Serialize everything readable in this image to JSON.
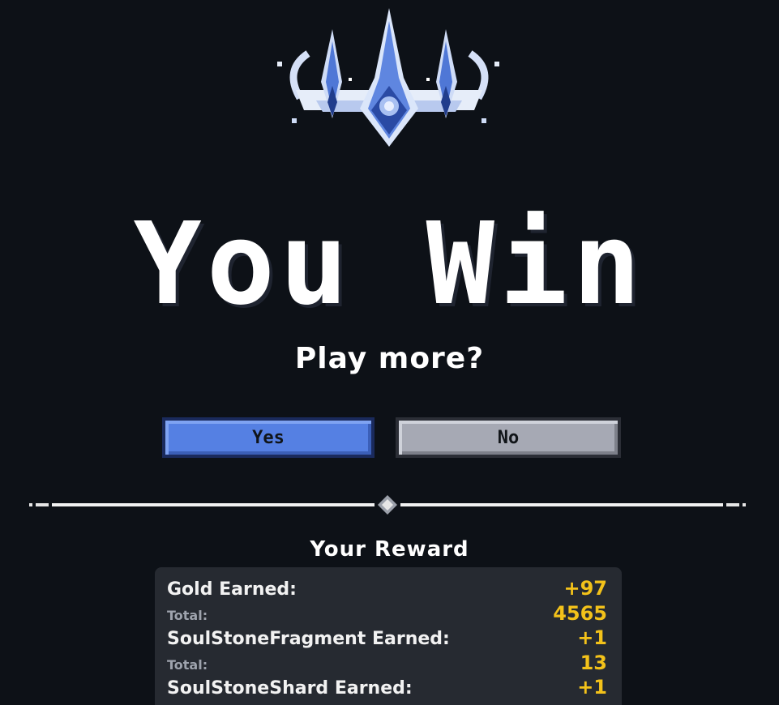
{
  "title": "You Win",
  "subtitle": "Play more?",
  "buttons": {
    "yes_label": "Yes",
    "no_label": "No"
  },
  "colors": {
    "background": "#0d1117",
    "yes_button": "#5580e3",
    "no_button": "#a6a9b4",
    "reward_value": "#f3c21a",
    "panel": "#262a31"
  },
  "icons": {
    "crown": "crown-icon",
    "divider_ornament": "diamond-ornament-icon"
  },
  "reward": {
    "title": "Your Reward",
    "rows": [
      {
        "earned_label": "Gold Earned:",
        "earned_value": "+97",
        "total_label": "Total:",
        "total_value": "4565"
      },
      {
        "earned_label": "SoulStoneFragment Earned:",
        "earned_value": "+1",
        "total_label": "Total:",
        "total_value": "13"
      },
      {
        "earned_label": "SoulStoneShard Earned:",
        "earned_value": "+1"
      }
    ]
  }
}
